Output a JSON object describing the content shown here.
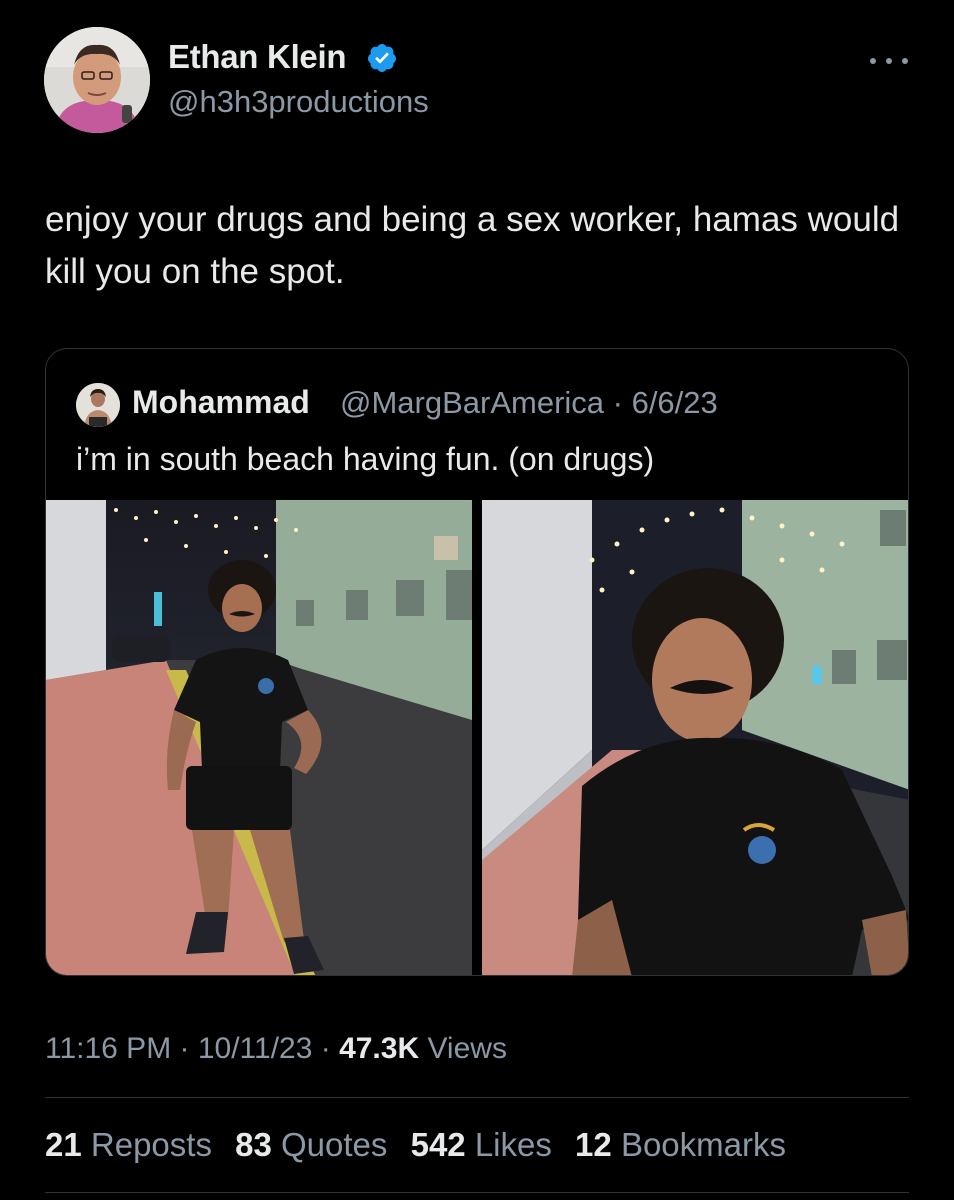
{
  "author": {
    "name": "Ethan Klein",
    "handle": "@h3h3productions",
    "verified": true,
    "verified_color": "#1d9bf0"
  },
  "tweet": {
    "text": "enjoy your drugs and being a sex worker, hamas would kill you on the spot."
  },
  "quote": {
    "name": "Mohammad",
    "handle_date": "@MargBarAmerica · 6/6/23",
    "text": "i’m in south beach having fun. (on drugs)"
  },
  "meta": {
    "time_date": "11:16 PM · 10/11/23 · ",
    "views_count": "47.3K",
    "views_label": " Views"
  },
  "stats": [
    {
      "count": "21",
      "label": "Reposts"
    },
    {
      "count": "83",
      "label": "Quotes"
    },
    {
      "count": "542",
      "label": "Likes"
    },
    {
      "count": "12",
      "label": "Bookmarks"
    }
  ],
  "icons": {
    "more": "more-icon",
    "verified": "verified-badge-icon"
  },
  "colors": {
    "background": "#000000",
    "text": "#e7e9ea",
    "muted": "#8b98a5",
    "border": "#2f3336"
  }
}
